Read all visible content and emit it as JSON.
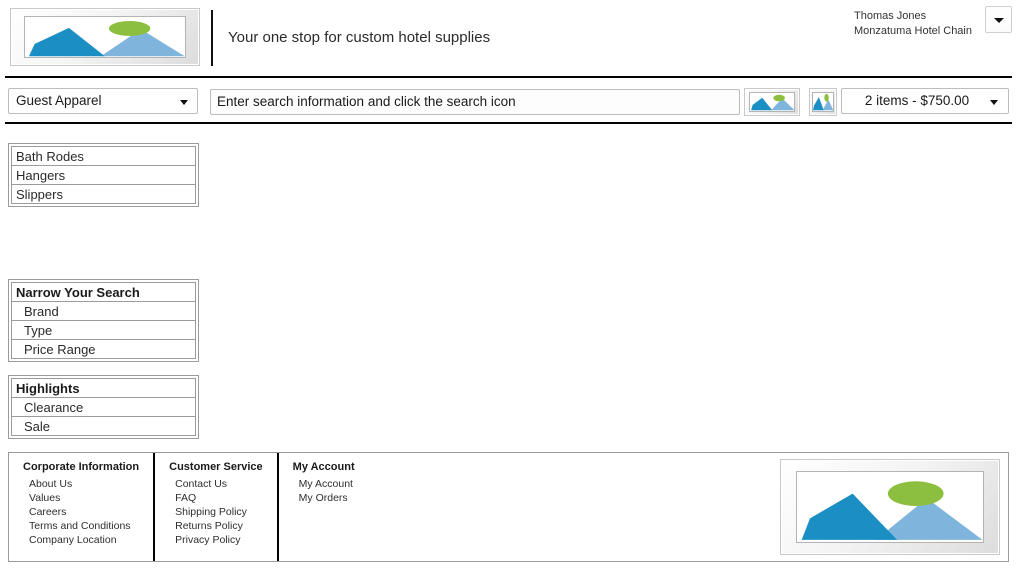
{
  "header": {
    "logo_alt": "image-placeholder-logo",
    "tagline": "Your one stop for custom hotel supplies",
    "user": {
      "name": "Thomas Jones",
      "organization": "Monzatuma Hotel Chain"
    },
    "dropdown_icon": "chevron-down-icon"
  },
  "searchbar": {
    "category_selected": "Guest Apparel",
    "category_caret": "chevron-down-icon",
    "search_placeholder": "Enter search information and click the search icon",
    "search_value": "Enter search information and click the search icon",
    "search_icon": "search-image-icon",
    "cart_icon": "cart-image-icon",
    "cart_summary": "2 items - $750.00",
    "cart_caret": "chevron-down-icon"
  },
  "sidebar": {
    "categories": [
      {
        "label": "Bath Rodes"
      },
      {
        "label": "Hangers"
      },
      {
        "label": "Slippers"
      }
    ],
    "narrow_search": {
      "title": "Narrow Your Search",
      "items": [
        {
          "label": "Brand"
        },
        {
          "label": "Type"
        },
        {
          "label": "Price Range"
        }
      ]
    },
    "highlights": {
      "title": "Highlights",
      "items": [
        {
          "label": "Clearance"
        },
        {
          "label": "Sale"
        }
      ]
    }
  },
  "footer": {
    "columns": [
      {
        "title": "Corporate Information",
        "links": [
          "About Us",
          "Values",
          "Careers",
          "Terms and Conditions",
          "Company Location"
        ]
      },
      {
        "title": "Customer Service",
        "links": [
          "Contact Us",
          "FAQ",
          "Shipping Policy",
          "Returns Policy",
          "Privacy Policy"
        ]
      },
      {
        "title": "My Account",
        "links": [
          "My Account",
          "My Orders"
        ]
      }
    ],
    "logo_alt": "image-placeholder-logo"
  },
  "colors": {
    "mountain_dark": "#1b8fc4",
    "mountain_light": "#7fb5dc",
    "sun": "#8cbf3f",
    "divider": "#000000",
    "panel_border": "#9b9b9b"
  }
}
